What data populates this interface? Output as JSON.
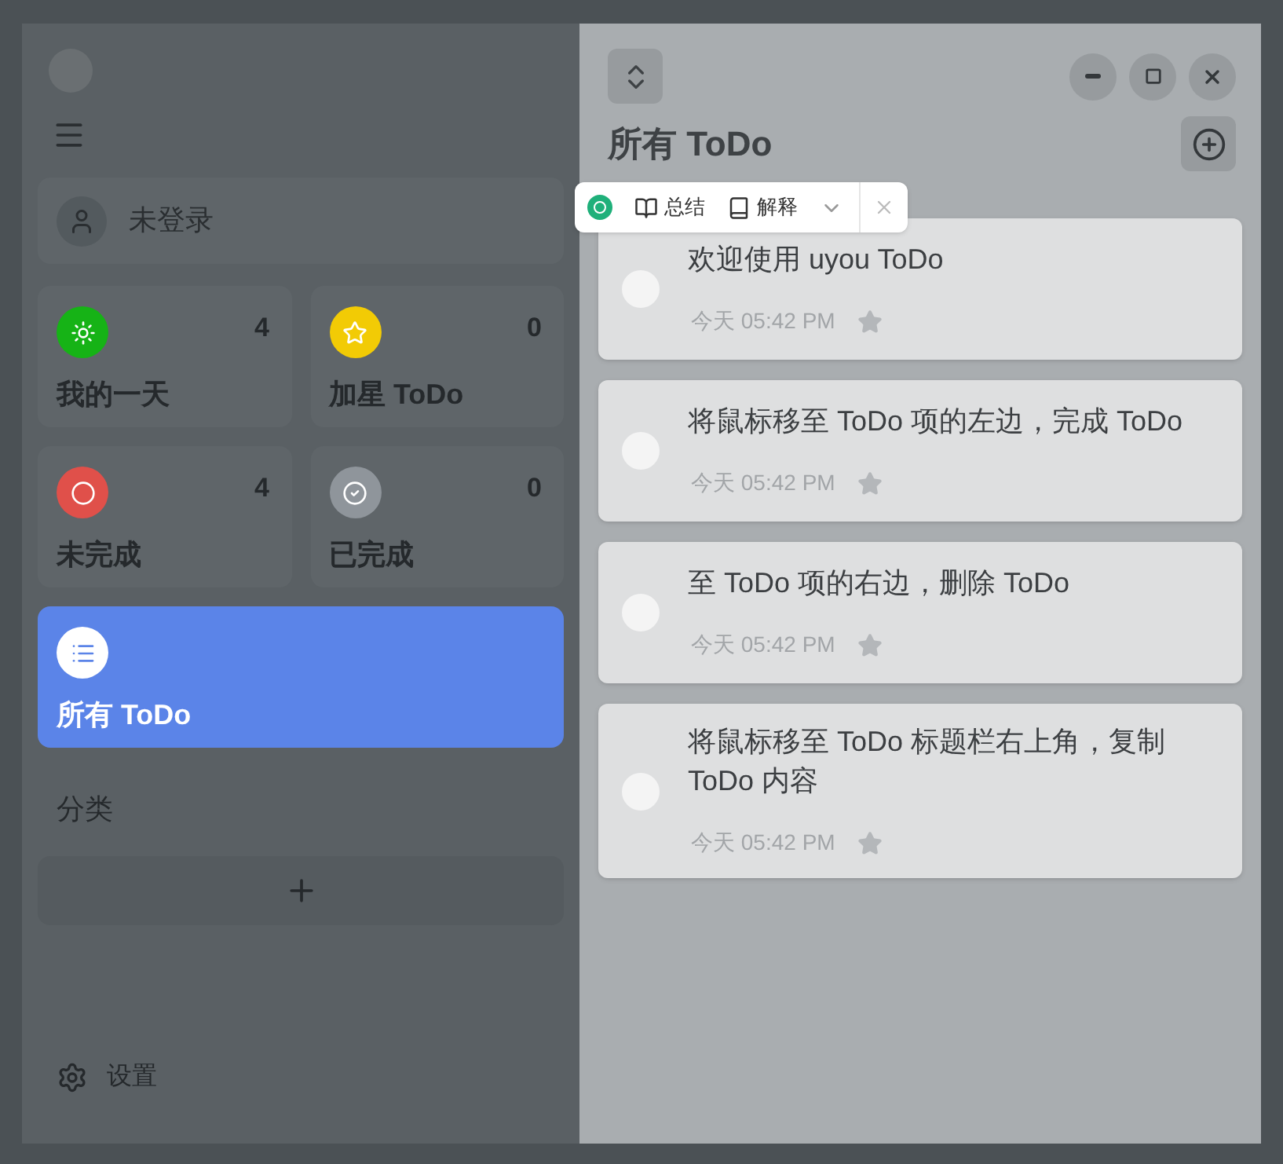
{
  "sidebar": {
    "user": "未登录",
    "lists": [
      {
        "kind": "sun",
        "name": "我的一天",
        "count": "4",
        "color": "#16b316",
        "selected": false
      },
      {
        "kind": "star",
        "name": "加星 ToDo",
        "count": "0",
        "color": "#f2cb05",
        "selected": false
      },
      {
        "kind": "circle",
        "name": "未完成",
        "count": "4",
        "color": "#e0504a",
        "selected": false
      },
      {
        "kind": "check",
        "name": "已完成",
        "count": "0",
        "color": "#8f959b",
        "selected": false
      },
      {
        "kind": "list",
        "name": "所有 ToDo",
        "color": "#ffffff",
        "selected": true
      }
    ],
    "categories_heading": "分类",
    "settings": "设置"
  },
  "main": {
    "title": "所有 ToDo",
    "todos": [
      {
        "text": "欢迎使用 uyou ToDo",
        "time": "今天 05:42 PM",
        "starred": false
      },
      {
        "text": "将鼠标移至 ToDo 项的左边，完成 ToDo",
        "time": "今天 05:42 PM",
        "starred": false
      },
      {
        "text": "至 ToDo 项的右边，删除 ToDo",
        "time": "今天 05:42 PM",
        "starred": false
      },
      {
        "text": "将鼠标移至 ToDo 标题栏右上角，复制 ToDo 内容",
        "time": "今天 05:42 PM",
        "starred": false
      }
    ]
  },
  "popup": {
    "actions": [
      {
        "kind": "open-book",
        "label": "总结"
      },
      {
        "kind": "book",
        "label": "解释"
      }
    ]
  }
}
